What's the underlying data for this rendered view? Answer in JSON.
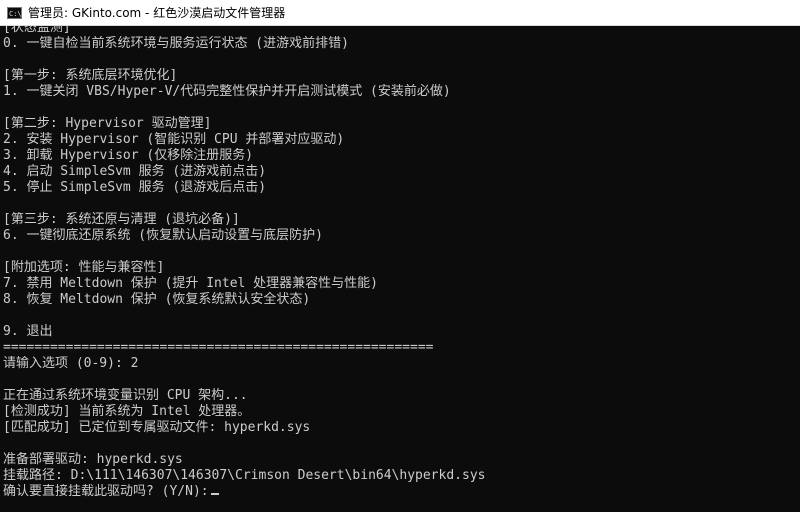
{
  "window": {
    "title": "管理员: GKinto.com - 红色沙漠启动文件管理器",
    "icon": "cmd-console-icon"
  },
  "console": {
    "lines": {
      "l0": "[状态监测]",
      "l1": "0. 一键自检当前系统环境与服务运行状态 (进游戏前排错)",
      "l3": "[第一步: 系统底层环境优化]",
      "l4": "1. 一键关闭 VBS/Hyper-V/代码完整性保护并开启测试模式 (安装前必做)",
      "l6": "[第二步: Hypervisor 驱动管理]",
      "l7": "2. 安装 Hypervisor (智能识别 CPU 并部署对应驱动)",
      "l8": "3. 卸载 Hypervisor (仅移除注册服务)",
      "l9": "4. 启动 SimpleSvm 服务 (进游戏前点击)",
      "l10": "5. 停止 SimpleSvm 服务 (退游戏后点击)",
      "l12": "[第三步: 系统还原与清理 (退坑必备)]",
      "l13": "6. 一键彻底还原系统 (恢复默认启动设置与底层防护)",
      "l15": "[附加选项: 性能与兼容性]",
      "l16": "7. 禁用 Meltdown 保护 (提升 Intel 处理器兼容性与性能)",
      "l17": "8. 恢复 Meltdown 保护 (恢复系统默认安全状态)",
      "l19": "9. 退出",
      "l20": "=======================================================",
      "l21": "请输入选项 (0-9): 2",
      "l23": "正在通过系统环境变量识别 CPU 架构...",
      "l24": "[检测成功] 当前系统为 Intel 处理器。",
      "l25": "[匹配成功] 已定位到专属驱动文件: hyperkd.sys",
      "l27": "准备部署驱动: hyperkd.sys",
      "l28": "挂载路径: D:\\111\\146307\\146307\\Crimson Desert\\bin64\\hyperkd.sys",
      "l29": "确认要直接挂载此驱动吗? (Y/N):"
    }
  },
  "colors": {
    "background": "#0c0c0c",
    "text": "#cccccc",
    "titlebar": "#ffffff"
  }
}
